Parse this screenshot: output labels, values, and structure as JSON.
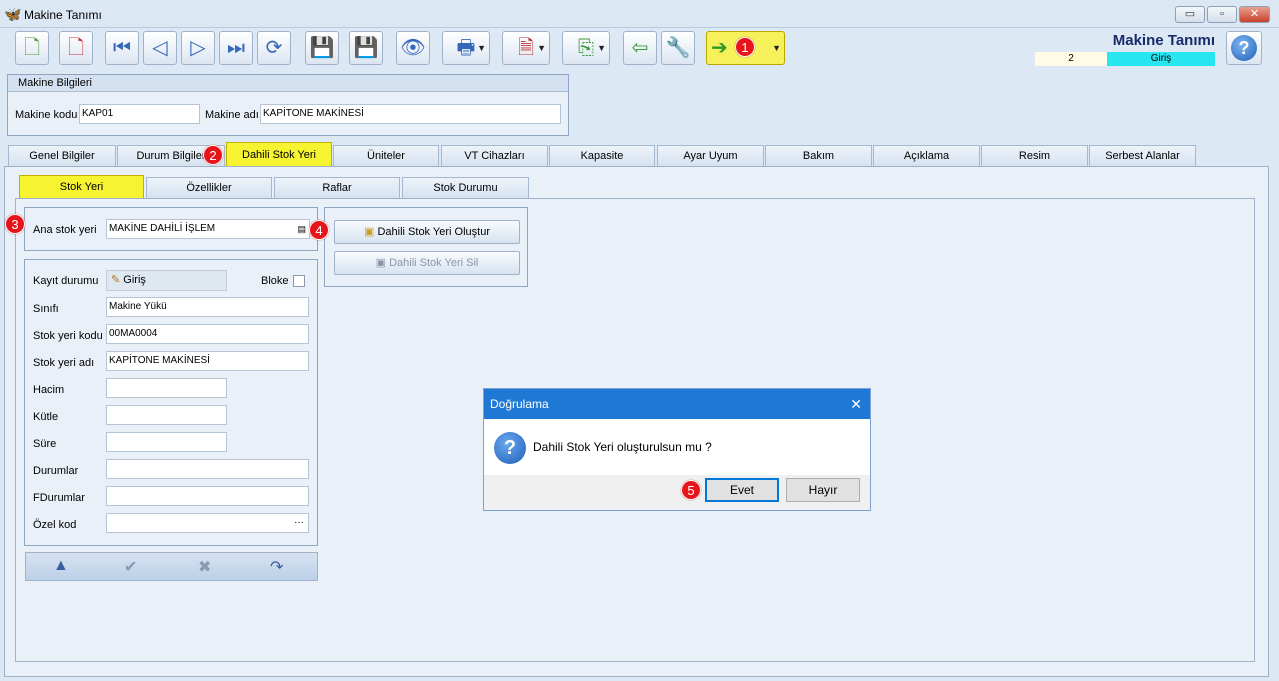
{
  "window": {
    "title": "Makine Tanımı",
    "minimize": "▭",
    "maximize": "▫",
    "close": "✕"
  },
  "toolbar": {
    "buttons": [
      {
        "icon": "new-doc-icon"
      },
      {
        "icon": "delete-doc-icon"
      },
      {
        "icon": "first-icon"
      },
      {
        "icon": "prev-icon"
      },
      {
        "icon": "next-icon"
      },
      {
        "icon": "last-icon"
      },
      {
        "icon": "refresh-icon"
      },
      {
        "icon": "save-icon"
      },
      {
        "icon": "save-cancel-icon"
      },
      {
        "icon": "preview-icon"
      },
      {
        "icon": "print-icon"
      },
      {
        "icon": "pdf-icon"
      },
      {
        "icon": "export-icon"
      },
      {
        "icon": "import-icon"
      },
      {
        "icon": "tools-icon"
      },
      {
        "icon": "exit-icon"
      }
    ]
  },
  "header": {
    "title": "Makine Tanımı",
    "record_no": "2",
    "mode": "Giriş"
  },
  "markers": {
    "m1": "1",
    "m2": "2",
    "m3": "3",
    "m4": "4",
    "m5": "5"
  },
  "machine_info": {
    "group_title": "Makine Bilgileri",
    "code_label": "Makine kodu",
    "code_value": "KAP01",
    "name_label": "Makine adı",
    "name_value": "KAPİTONE MAKİNESİ"
  },
  "tabs": [
    "Genel Bilgiler",
    "Durum Bilgiler",
    "Dahili Stok Yeri",
    "Üniteler",
    "VT Cihazları",
    "Kapasite",
    "Ayar Uyum",
    "Bakım",
    "Açıklama",
    "Resim",
    "Serbest Alanlar"
  ],
  "subtabs": [
    "Stok Yeri",
    "Özellikler",
    "Raflar",
    "Stok Durumu"
  ],
  "stock": {
    "main_label": "Ana stok yeri",
    "main_value": "MAKİNE DAHİLİ İŞLEM",
    "create_btn": "Dahili Stok Yeri Oluştur",
    "delete_btn": "Dahili Stok Yeri Sil"
  },
  "form": {
    "record_status_label": "Kayıt durumu",
    "record_status_value": "Giriş",
    "block_label": "Bloke",
    "class_label": "Sınıfı",
    "class_value": "Makine Yükü",
    "code_label": "Stok yeri kodu",
    "code_value": "00MA0004",
    "name_label": "Stok yeri adı",
    "name_value": "KAPİTONE MAKİNESİ",
    "volume_label": "Hacim",
    "mass_label": "Kütle",
    "duration_label": "Süre",
    "states_label": "Durumlar",
    "fstates_label": "FDurumlar",
    "special_label": "Özel kod",
    "ellipsis": "···"
  },
  "dialog": {
    "title": "Doğrulama",
    "message": "Dahili Stok Yeri oluşturulsun mu ?",
    "yes": "Evet",
    "no": "Hayır",
    "close": "✕"
  }
}
